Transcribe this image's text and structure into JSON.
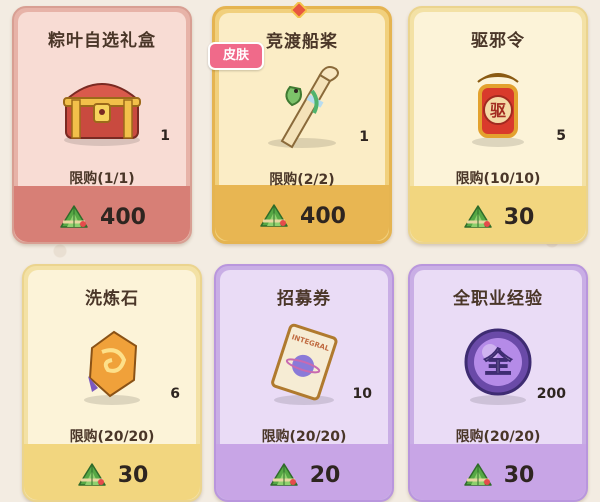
{
  "shop": {
    "items": [
      {
        "name": "粽叶自选礼盒",
        "quantity": "1",
        "limit": "限购(1/1)",
        "price": "400",
        "theme": "red"
      },
      {
        "name": "竞渡船桨",
        "quantity": "1",
        "limit": "限购(2/2)",
        "price": "400",
        "theme": "gold",
        "badge": "皮肤"
      },
      {
        "name": "驱邪令",
        "quantity": "5",
        "limit": "限购(10/10)",
        "price": "30",
        "theme": "yellow"
      },
      {
        "name": "洗炼石",
        "quantity": "6",
        "limit": "限购(20/20)",
        "price": "30",
        "theme": "yellow"
      },
      {
        "name": "招募券",
        "quantity": "10",
        "limit": "限购(20/20)",
        "price": "20",
        "theme": "purple"
      },
      {
        "name": "全职业经验",
        "quantity": "200",
        "limit": "限购(20/20)",
        "price": "30",
        "theme": "purple",
        "glyph": "全"
      }
    ],
    "currency_icon": "zongzi-icon",
    "item_icons": [
      "treasure-chest-icon",
      "paddle-icon",
      "dragon-token-icon",
      "refining-stone-icon",
      "recruit-ticket-icon",
      "experience-orb-icon"
    ],
    "token_glyph": "驱",
    "ticket_text": "INTEGRAL"
  },
  "colors": {
    "red_footer": "#d77f76",
    "gold_footer": "#e8b652",
    "yellow_footer": "#f2d67f",
    "purple_footer": "#c8a5e6",
    "badge": "#f06a8a"
  }
}
